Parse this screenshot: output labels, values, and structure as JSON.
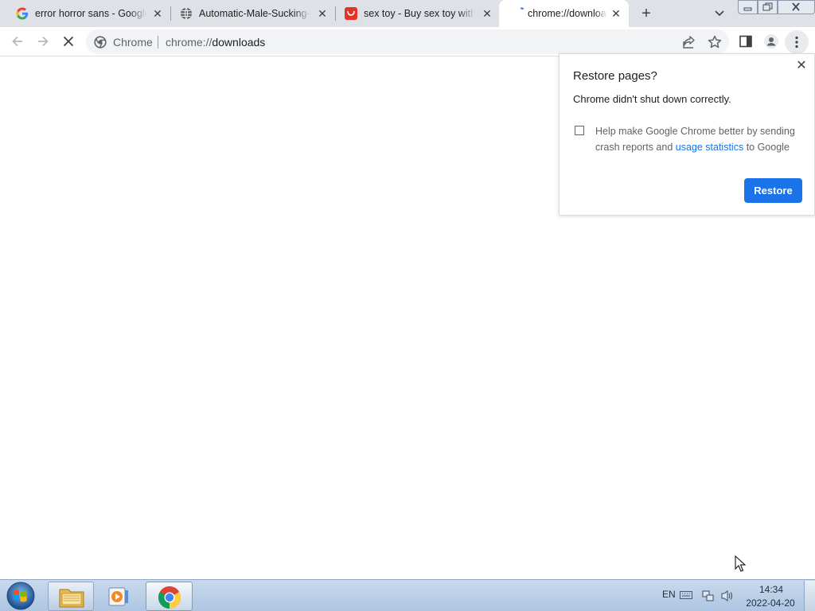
{
  "tabs": [
    {
      "title": "error horror sans - Google",
      "favicon": "google-g-icon"
    },
    {
      "title": "Automatic-Male-Sucking-Ma",
      "favicon": "globe-icon"
    },
    {
      "title": "sex toy - Buy sex toy with f",
      "favicon": "aliexpress-icon"
    },
    {
      "title": "chrome://downloads",
      "favicon": "loading-icon",
      "active": true
    }
  ],
  "toolbar": {
    "omnibox_site_label": "Chrome",
    "omnibox_url_scheme": "chrome://",
    "omnibox_url_path": "downloads"
  },
  "restore_bubble": {
    "title": "Restore pages?",
    "message": "Chrome didn't shut down correctly.",
    "consent_text_before": "Help make Google Chrome better by sending crash reports and ",
    "consent_link": "usage statistics",
    "consent_text_after": " to Google",
    "consent_checked": false,
    "restore_label": "Restore"
  },
  "taskbar": {
    "language": "EN",
    "time": "14:34",
    "date": "2022-04-20"
  },
  "colors": {
    "accent": "#1a73e8",
    "tabstrip": "#dee1e6",
    "omnibox": "#f1f3f4"
  }
}
